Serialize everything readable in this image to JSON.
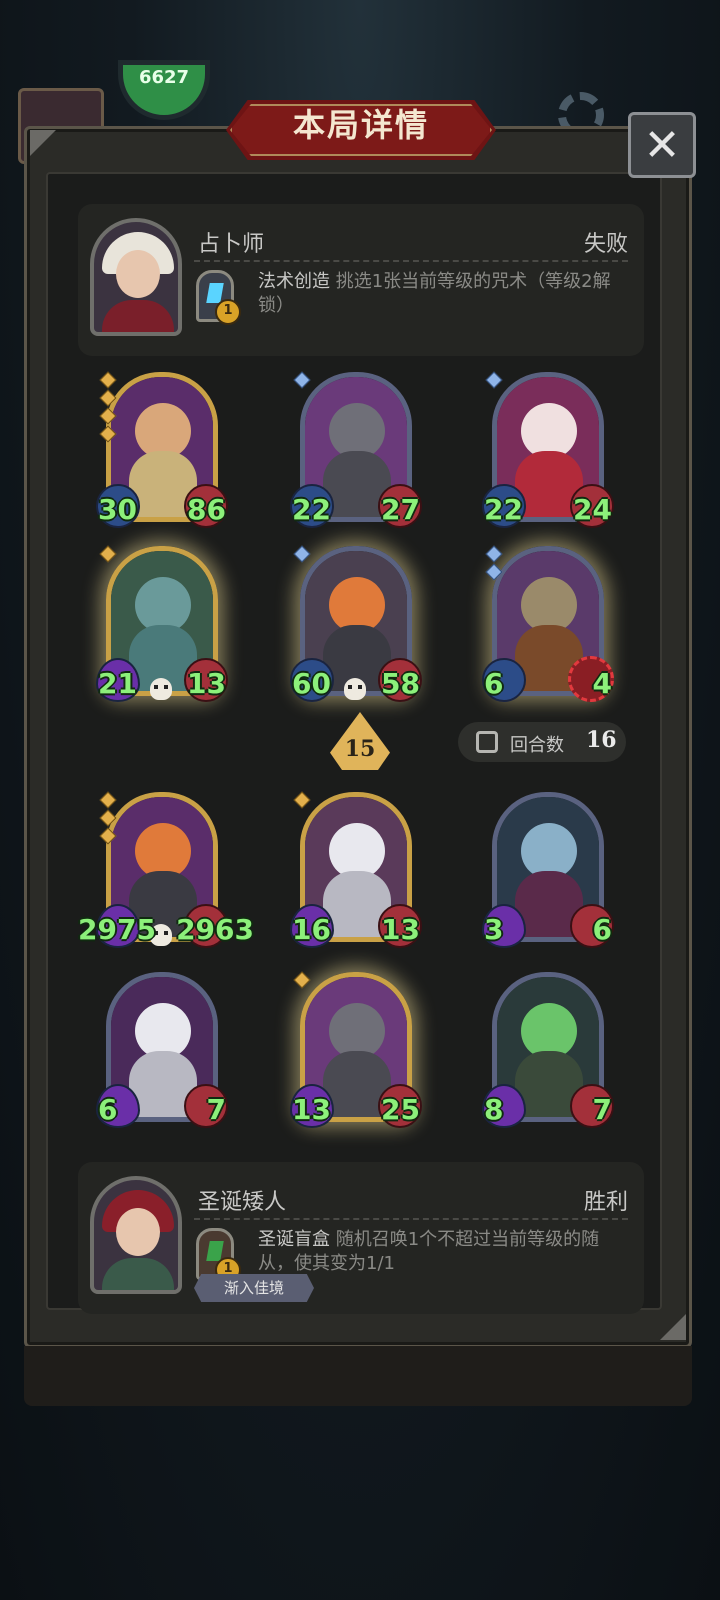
{
  "background": {
    "top_badge_text": "6627"
  },
  "title": "本局详情",
  "close_icon": "close-icon",
  "opponent": {
    "name": "占卜师",
    "result": "失败",
    "skill_name": "法术创造",
    "skill_desc": "挑选1张当前等级的咒术（等级2解锁）",
    "skill_level": "1"
  },
  "opponent_cards": [
    {
      "atk": "30",
      "hp": "86",
      "tier": "gold"
    },
    {
      "atk": "22",
      "hp": "27",
      "tier": "normal"
    },
    {
      "atk": "22",
      "hp": "24",
      "tier": "normal"
    },
    {
      "atk": "21",
      "hp": "13",
      "tier": "gold"
    },
    {
      "atk": "60",
      "hp": "58",
      "tier": "normal"
    },
    {
      "atk": "6",
      "hp": "4",
      "tier": "gold"
    }
  ],
  "tavern_tier": "15",
  "round": {
    "label": "回合数",
    "value": "16"
  },
  "player_cards": [
    {
      "atk": "2975",
      "hp": "2963",
      "tier": "gold"
    },
    {
      "atk": "16",
      "hp": "13",
      "tier": "gold"
    },
    {
      "atk": "3",
      "hp": "6",
      "tier": "normal"
    },
    {
      "atk": "6",
      "hp": "7",
      "tier": "normal"
    },
    {
      "atk": "13",
      "hp": "25",
      "tier": "gold"
    },
    {
      "atk": "8",
      "hp": "7",
      "tier": "normal"
    }
  ],
  "player": {
    "name": "圣诞矮人",
    "result": "胜利",
    "skill_name": "圣诞盲盒",
    "skill_desc": "随机召唤1个不超过当前等级的随从，使其变为1/1",
    "skill_level": "1",
    "tag": "渐入佳境"
  }
}
